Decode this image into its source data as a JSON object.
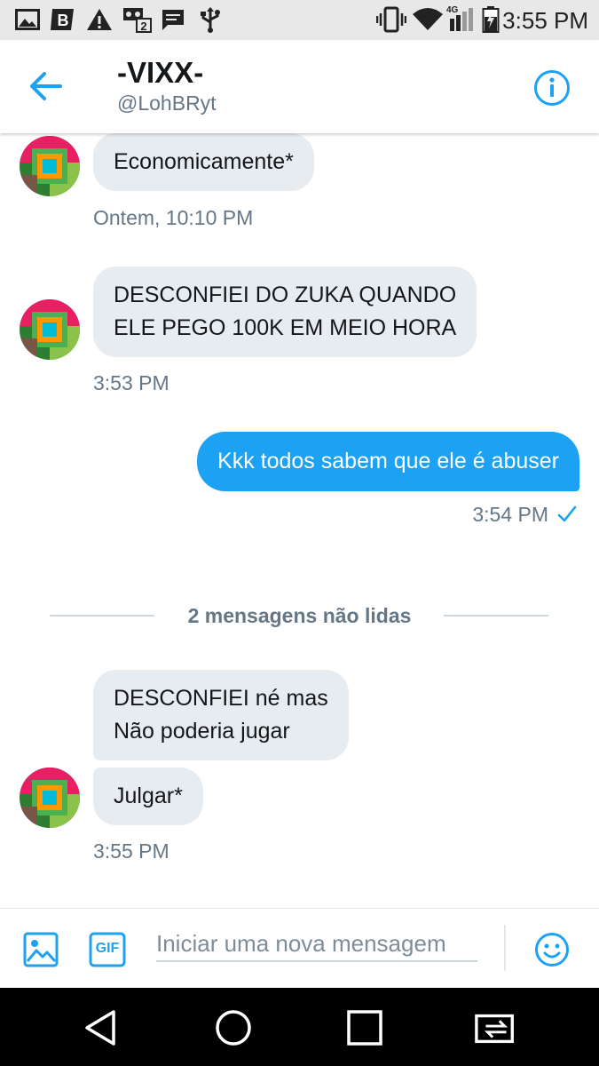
{
  "status_bar": {
    "time": "3:55 PM",
    "network_label": "4G",
    "icons": [
      "gallery-icon",
      "b-icon",
      "warning-icon",
      "voicemail-icon",
      "message-icon",
      "usb-icon",
      "vibrate-icon",
      "wifi-icon",
      "signal-icon",
      "battery-icon"
    ]
  },
  "header": {
    "name": "-VIXX-",
    "handle": "@LohBRyt"
  },
  "messages": {
    "m1": {
      "text": "Economicamente*",
      "time": "Ontem, 10:10 PM"
    },
    "m2": {
      "line1": "DESCONFIEI DO ZUKA QUANDO",
      "line2": "ELE PEGO 100K EM MEIO HORA",
      "time": "3:53 PM"
    },
    "m3": {
      "text": "Kkk todos sabem que ele é abuser",
      "time": "3:54 PM"
    },
    "unread_divider": "2 mensagens não lidas",
    "m4": {
      "line1": "DESCONFIEI né mas",
      "line2": "Não poderia jugar"
    },
    "m5": {
      "text": "Julgar*",
      "time": "3:55 PM"
    }
  },
  "composer": {
    "placeholder": "Iniciar uma nova mensagem",
    "gif_label": "GIF"
  },
  "colors": {
    "accent": "#1da1f2",
    "incoming_bubble": "#e6ecf0",
    "muted_text": "#657786"
  }
}
